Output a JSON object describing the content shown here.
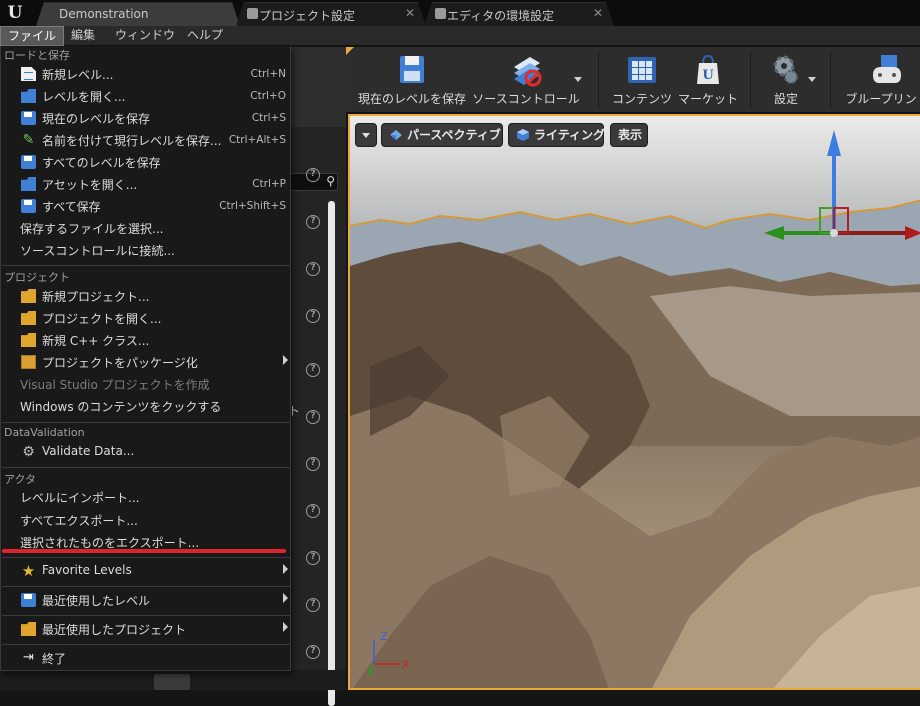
{
  "tabs": [
    {
      "label": "Demonstration",
      "active": true
    },
    {
      "label": "プロジェクト設定",
      "active": false
    },
    {
      "label": "エディタの環境設定",
      "active": false
    }
  ],
  "menubar": {
    "file": "ファイル",
    "edit": "編集",
    "window": "ウィンドウ",
    "help": "ヘルプ"
  },
  "file_menu": {
    "sections": {
      "load_save": "ロードと保存",
      "project": "プロジェクト",
      "data_validation": "DataValidation",
      "actor": "アクタ"
    },
    "items": {
      "new_level": {
        "label": "新規レベル...",
        "shortcut": "Ctrl+N"
      },
      "open_level": {
        "label": "レベルを開く...",
        "shortcut": "Ctrl+O"
      },
      "save_current": {
        "label": "現在のレベルを保存",
        "shortcut": "Ctrl+S"
      },
      "save_current_as": {
        "label": "名前を付けて現行レベルを保存...",
        "shortcut": "Ctrl+Alt+S"
      },
      "save_all_levels": {
        "label": "すべてのレベルを保存"
      },
      "open_asset": {
        "label": "アセットを開く...",
        "shortcut": "Ctrl+P"
      },
      "save_all": {
        "label": "すべて保存",
        "shortcut": "Ctrl+Shift+S"
      },
      "choose_files": {
        "label": "保存するファイルを選択..."
      },
      "connect_source": {
        "label": "ソースコントロールに接続..."
      },
      "new_project": {
        "label": "新規プロジェクト..."
      },
      "open_project": {
        "label": "プロジェクトを開く..."
      },
      "new_cpp": {
        "label": "新規 C++ クラス..."
      },
      "package_project": {
        "label": "プロジェクトをパッケージ化"
      },
      "vs_project": {
        "label": "Visual Studio プロジェクトを作成"
      },
      "cook_windows": {
        "label": "Windows のコンテンツをクックする"
      },
      "validate_data": {
        "label": "Validate Data..."
      },
      "import_level": {
        "label": "レベルにインポート..."
      },
      "export_all": {
        "label": "すべてエクスポート..."
      },
      "export_selected": {
        "label": "選択されたものをエクスポート..."
      },
      "favorite_levels": {
        "label": "Favorite Levels"
      },
      "recent_levels": {
        "label": "最近使用したレベル"
      },
      "recent_projects": {
        "label": "最近使用したプロジェクト"
      },
      "exit": {
        "label": "終了"
      }
    }
  },
  "left_panel": {
    "partial_text": "ト"
  },
  "toolbar": {
    "save_current": "現在のレベルを保存",
    "source_control": "ソースコントロール",
    "content": "コンテンツ",
    "marketplace": "マーケット",
    "settings": "設定",
    "blueprints": "ブループリント"
  },
  "viewport": {
    "perspective": "パースペクティブ",
    "lighting": "ライティング",
    "show": "表示",
    "axis_z": "Z",
    "axis_x": "X"
  },
  "colors": {
    "accent": "#e8a93b",
    "highlight_underline": "#e0212e",
    "gizmo_z": "#3b7ee0",
    "gizmo_x": "#b01a1a",
    "gizmo_y": "#2c8f1a"
  }
}
